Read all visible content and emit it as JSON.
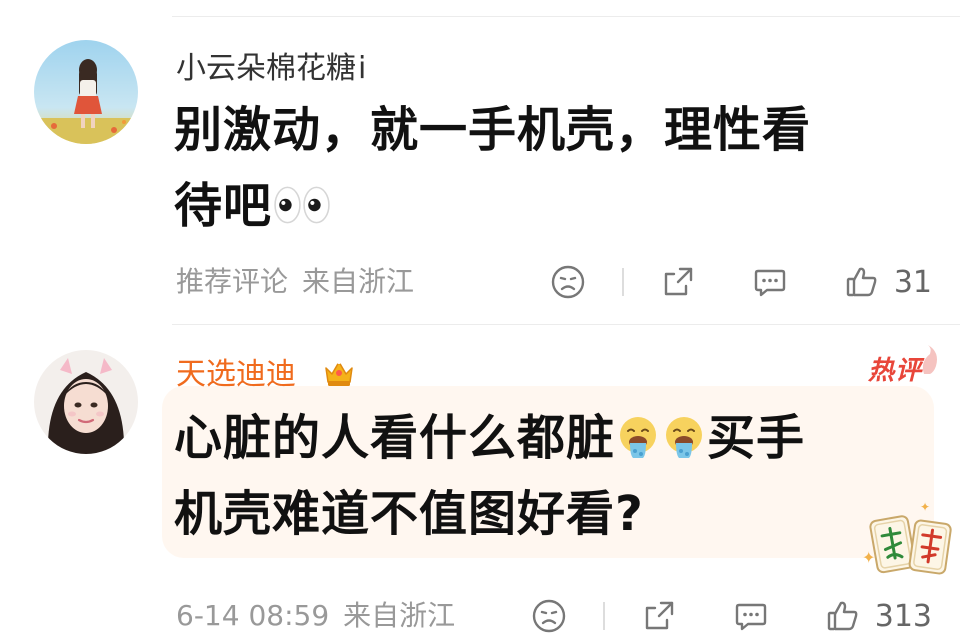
{
  "comments": [
    {
      "username": "小云朵棉花糖",
      "verify_mark": "i",
      "text_line1": "别激动，就一手机壳，理性看",
      "text_line2": "待吧",
      "inline_emoji": "eyes-emoji",
      "tag": "推荐评论",
      "location": "来自浙江",
      "like_count": "31"
    },
    {
      "username": "天选迪迪",
      "badge_icon": "crown-icon",
      "hot_label": "热评",
      "text_line1_a": "心脏的人看什么都脏",
      "text_line1_b": "买手",
      "text_line2": "机壳难道不值图好看?",
      "inline_emoji": "vomit-emoji",
      "timestamp": "6-14 08:59",
      "location": "来自浙江",
      "like_count": "313",
      "sticker": "mahjong-fa-cai-sticker"
    }
  ],
  "actions": {
    "dislike_icon": "frown-face-icon",
    "share_icon": "share-icon",
    "comment_icon": "comment-bubble-icon",
    "like_icon": "thumbs-up-icon"
  },
  "colors": {
    "hot_username": "#f06b1e",
    "hot_label": "#e8463a",
    "hot_bubble_bg": "#fff7f0",
    "meta_text": "#999999"
  }
}
